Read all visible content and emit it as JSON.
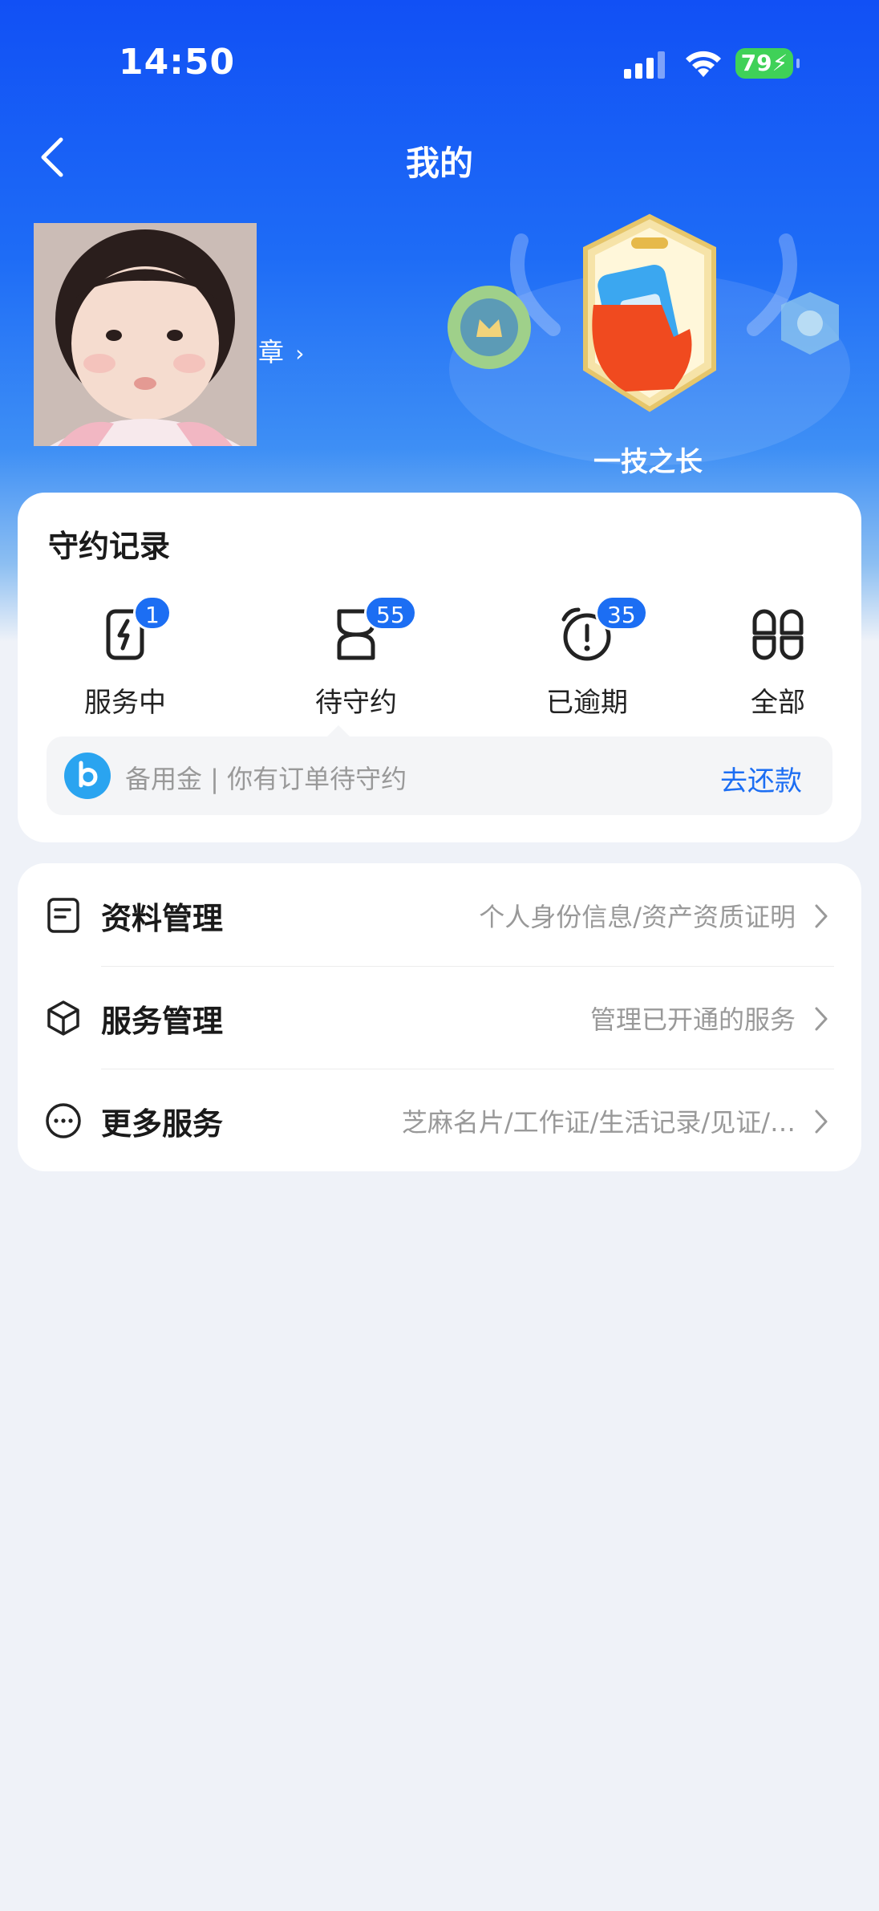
{
  "status_bar": {
    "time": "14:50",
    "battery": "79"
  },
  "nav": {
    "title": "我的"
  },
  "profile": {
    "medal_link": "章"
  },
  "badge": {
    "name": "一技之长"
  },
  "records": {
    "title": "守约记录",
    "stats": [
      {
        "label": "服务中",
        "count": "1"
      },
      {
        "label": "待守约",
        "count": "55"
      },
      {
        "label": "已逾期",
        "count": "35"
      },
      {
        "label": "全部"
      }
    ],
    "notice": {
      "text": "备用金 | 你有订单待守约",
      "action": "去还款"
    }
  },
  "menu": [
    {
      "label": "资料管理",
      "subtitle": "个人身份信息/资产资质证明"
    },
    {
      "label": "服务管理",
      "subtitle": "管理已开通的服务"
    },
    {
      "label": "更多服务",
      "subtitle": "芝麻名片/工作证/生活记录/见证/…"
    }
  ],
  "colors": {
    "accent": "#1c6ef3",
    "hero_top": "#1150f5",
    "page_bg": "#eff2f8",
    "battery": "#3fd158"
  }
}
